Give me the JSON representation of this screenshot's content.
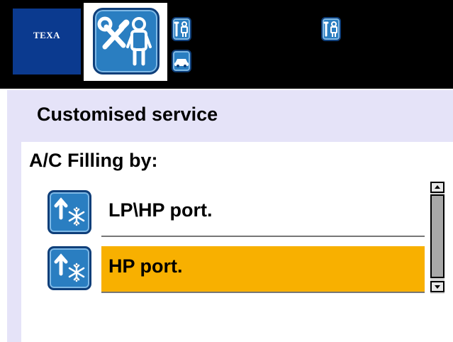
{
  "header": {
    "logo_text": "TEXA",
    "main_icon": "service-tools-person-icon",
    "small_icons": [
      "tools-person-icon",
      "car-icon",
      "tools-person-icon"
    ]
  },
  "page": {
    "title": "Customised service"
  },
  "menu": {
    "heading": "A/C Filling by:",
    "selected_index": 1,
    "options": [
      {
        "label": "LP\\HP port.",
        "icon": "refill-up-snowflake-icon"
      },
      {
        "label": "HP port.",
        "icon": "refill-up-snowflake-icon"
      }
    ]
  },
  "colors": {
    "header_bg": "#000000",
    "logo_bg": "#0b3a8f",
    "icon_blue": "#2a7ec1",
    "band_bg": "#e5e3f8",
    "selection": "#f8b000"
  }
}
